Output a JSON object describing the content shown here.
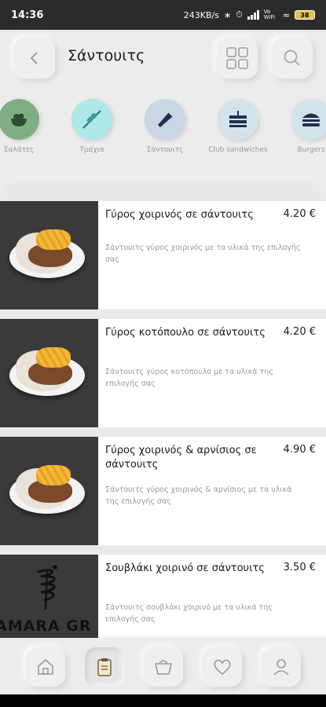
{
  "status_bar": {
    "time": "14:36",
    "network_speed": "243KB/s",
    "battery": "38",
    "vowifi": "Vo WiFi"
  },
  "header": {
    "title": "Σάντουιτς"
  },
  "categories": [
    {
      "label": "Σαλάτες",
      "icon": "salad-icon",
      "color": "#7fae84"
    },
    {
      "label": "Τμάχια",
      "icon": "skewer-icon",
      "color": "#aee8e8"
    },
    {
      "label": "Σάντουιτς",
      "icon": "wrap-icon",
      "color": "#c9d6e6"
    },
    {
      "label": "Club sandwiches",
      "icon": "club-sandwich-icon",
      "color": "#d3e3ec"
    },
    {
      "label": "Burgers",
      "icon": "burger-icon",
      "color": "#d3e3ec"
    }
  ],
  "products": [
    {
      "name": "Γύρος χοιρινός σε σάντουιτς",
      "price": "4.20 €",
      "description": "Σάντουιτς γύρος χοιρινός με τα υλικά της επιλογής σας"
    },
    {
      "name": "Γύρος κοτόπουλο σε σάντουιτς",
      "price": "4.20 €",
      "description": "Σάντουιτς γύρος κοτόπουλο με τα υλικά της επιλογής σας"
    },
    {
      "name": "Γύρος χοιρινός & αρνίσιος σε σάντουιτς",
      "price": "4.90 €",
      "description": "Σάντουιτς γύρος χοιρινός & αρνίσιος με τα υλικά της επιλογής σας"
    },
    {
      "name": "Σουβλάκι χοιρινό σε σάντουιτς",
      "price": "3.50 €",
      "description": "Σάντουιτς σουβλάκι χοιρινό με τα υλικά της επιλογής σας",
      "logo_text": "AMARA GR"
    }
  ],
  "bottom_nav": [
    {
      "icon": "home-icon"
    },
    {
      "icon": "menu-icon",
      "active": true
    },
    {
      "icon": "basket-icon"
    },
    {
      "icon": "heart-icon"
    },
    {
      "icon": "user-icon"
    }
  ]
}
